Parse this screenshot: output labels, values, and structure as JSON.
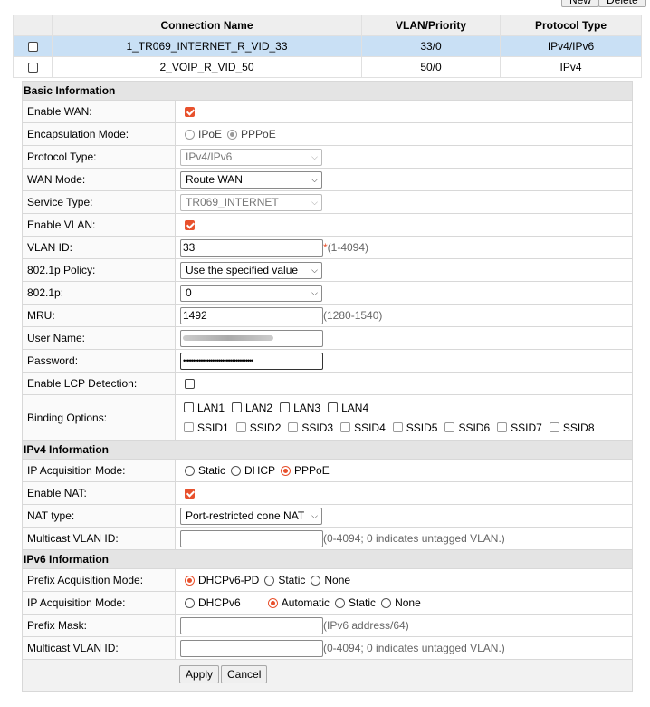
{
  "toolbar": {
    "new_label": "New",
    "delete_label": "Delete"
  },
  "connections": {
    "headers": [
      "Connection Name",
      "VLAN/Priority",
      "Protocol Type"
    ],
    "rows": [
      {
        "name": "1_TR069_INTERNET_R_VID_33",
        "vlan": "33/0",
        "protocol": "IPv4/IPv6"
      },
      {
        "name": "2_VOIP_R_VID_50",
        "vlan": "50/0",
        "protocol": "IPv4"
      }
    ]
  },
  "basic": {
    "title": "Basic Information",
    "enable_wan": "Enable WAN:",
    "encap": "Encapsulation Mode:",
    "encap_ipoe": "IPoE",
    "encap_pppoe": "PPPoE",
    "protocol_type": "Protocol Type:",
    "protocol_type_value": "IPv4/IPv6",
    "wan_mode": "WAN Mode:",
    "wan_mode_value": "Route WAN",
    "service_type": "Service Type:",
    "service_type_value": "TR069_INTERNET",
    "enable_vlan": "Enable VLAN:",
    "vlan_id": "VLAN ID:",
    "vlan_id_value": "33",
    "vlan_id_req": "*",
    "vlan_id_hint": "(1-4094)",
    "policy": "802.1p Policy:",
    "policy_value": "Use the specified value",
    "p8021": "802.1p:",
    "p8021_value": "0",
    "mru": "MRU:",
    "mru_value": "1492",
    "mru_hint": "(1280-1540)",
    "username": "User Name:",
    "password": "Password:",
    "password_value": "••••••••••••••••••••••••••••••••••••",
    "lcp": "Enable LCP Detection:",
    "binding": "Binding Options:",
    "lan": [
      "LAN1",
      "LAN2",
      "LAN3",
      "LAN4"
    ],
    "ssid": [
      "SSID1",
      "SSID2",
      "SSID3",
      "SSID4",
      "SSID5",
      "SSID6",
      "SSID7",
      "SSID8"
    ]
  },
  "ipv4": {
    "title": "IPv4 Information",
    "acq": "IP Acquisition Mode:",
    "acq_static": "Static",
    "acq_dhcp": "DHCP",
    "acq_pppoe": "PPPoE",
    "nat": "Enable NAT:",
    "nat_type": "NAT type:",
    "nat_type_value": "Port-restricted cone NAT",
    "mvlan": "Multicast VLAN ID:",
    "mvlan_hint": "(0-4094; 0 indicates untagged VLAN.)"
  },
  "ipv6": {
    "title": "IPv6 Information",
    "prefix_acq": "Prefix Acquisition Mode:",
    "pa_dhcp": "DHCPv6-PD",
    "pa_static": "Static",
    "pa_none": "None",
    "acq": "IP Acquisition Mode:",
    "ia_dhcp": "DHCPv6",
    "ia_auto": "Automatic",
    "ia_static": "Static",
    "ia_none": "None",
    "mask": "Prefix Mask:",
    "mask_hint": "(IPv6 address/64)",
    "mvlan": "Multicast VLAN ID:",
    "mvlan_hint": "(0-4094; 0 indicates untagged VLAN.)"
  },
  "actions": {
    "apply": "Apply",
    "cancel": "Cancel"
  },
  "colors": {
    "accent": "#e8512d",
    "selected_row": "#c9e0f5"
  }
}
